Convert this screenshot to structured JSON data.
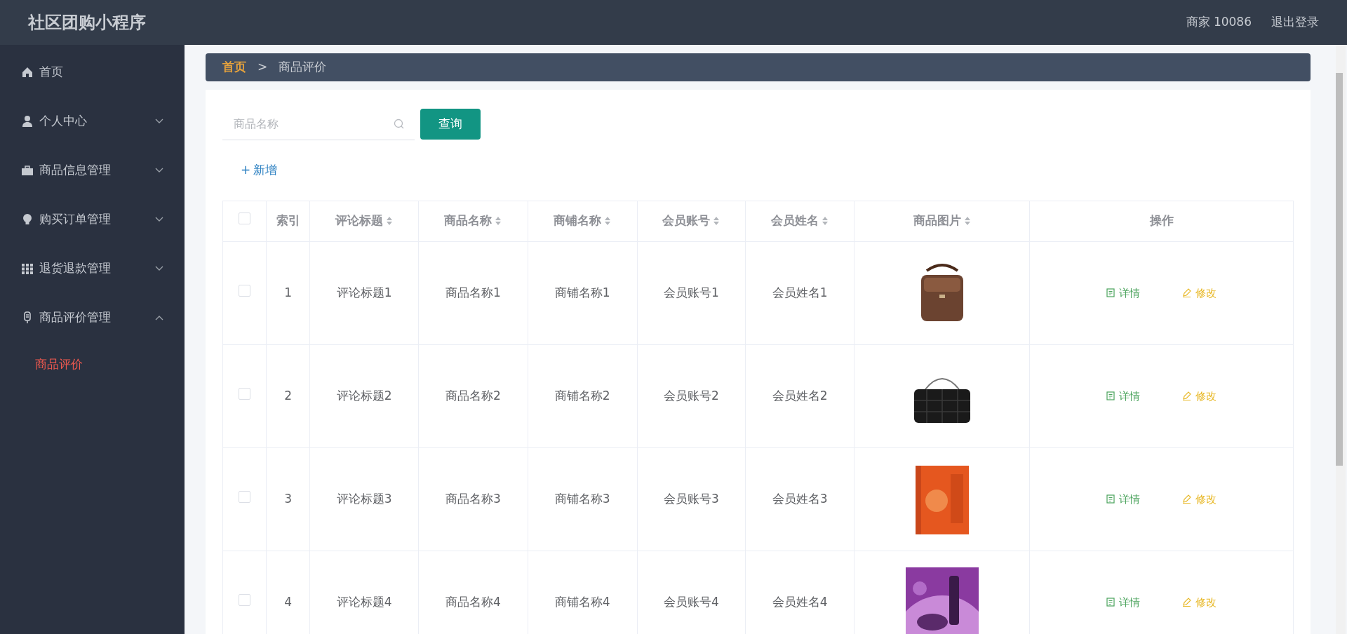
{
  "header": {
    "title": "社区团购小程序",
    "user": "商家 10086",
    "logout": "退出登录"
  },
  "sidebar": {
    "items": [
      {
        "kind": "home",
        "label": "首页",
        "expandable": false,
        "selected": false
      },
      {
        "kind": "person",
        "label": "个人中心",
        "expandable": true,
        "expanded": false,
        "selected": false
      },
      {
        "kind": "briefcase",
        "label": "商品信息管理",
        "expandable": true,
        "expanded": false,
        "selected": false
      },
      {
        "kind": "bulb",
        "label": "购买订单管理",
        "expandable": true,
        "expanded": false,
        "selected": false
      },
      {
        "kind": "grid",
        "label": "退货退款管理",
        "expandable": true,
        "expanded": false,
        "selected": false
      },
      {
        "kind": "mic",
        "label": "商品评价管理",
        "expandable": true,
        "expanded": true,
        "selected": false,
        "children": [
          {
            "label": "商品评价",
            "selected": true
          }
        ]
      }
    ]
  },
  "breadcrumb": [
    {
      "label": "首页",
      "current": false
    },
    {
      "separator": ">",
      "label": "商品评价",
      "current": true
    }
  ],
  "search": {
    "placeholder": "商品名称",
    "button": "查询"
  },
  "add_button": {
    "icon": "+",
    "label": "新增"
  },
  "table": {
    "select_all_checked": false,
    "columns": [
      {
        "label": "索引",
        "sortable": false
      },
      {
        "label": "评论标题",
        "sortable": true
      },
      {
        "label": "商品名称",
        "sortable": true
      },
      {
        "label": "商铺名称",
        "sortable": true
      },
      {
        "label": "会员账号",
        "sortable": true
      },
      {
        "label": "会员姓名",
        "sortable": true
      },
      {
        "label": "商品图片",
        "sortable": true
      },
      {
        "label": "操作",
        "sortable": false
      }
    ],
    "rows": [
      {
        "checked": false,
        "cells": [
          "1",
          "评论标题1",
          "商品名称1",
          "商铺名称1",
          "会员账号1",
          "会员姓名1"
        ],
        "actions": [
          "详情",
          "修改"
        ]
      },
      {
        "checked": false,
        "cells": [
          "2",
          "评论标题2",
          "商品名称2",
          "商铺名称2",
          "会员账号2",
          "会员姓名2"
        ],
        "actions": [
          "详情",
          "修改"
        ]
      },
      {
        "checked": false,
        "cells": [
          "3",
          "评论标题3",
          "商品名称3",
          "商铺名称3",
          "会员账号3",
          "会员姓名3"
        ],
        "actions": [
          "详情",
          "修改"
        ]
      },
      {
        "checked": false,
        "cells": [
          "4",
          "评论标题4",
          "商品名称4",
          "商铺名称4",
          "会员账号4",
          "会员姓名4"
        ],
        "actions": [
          "详情",
          "修改"
        ]
      }
    ]
  }
}
